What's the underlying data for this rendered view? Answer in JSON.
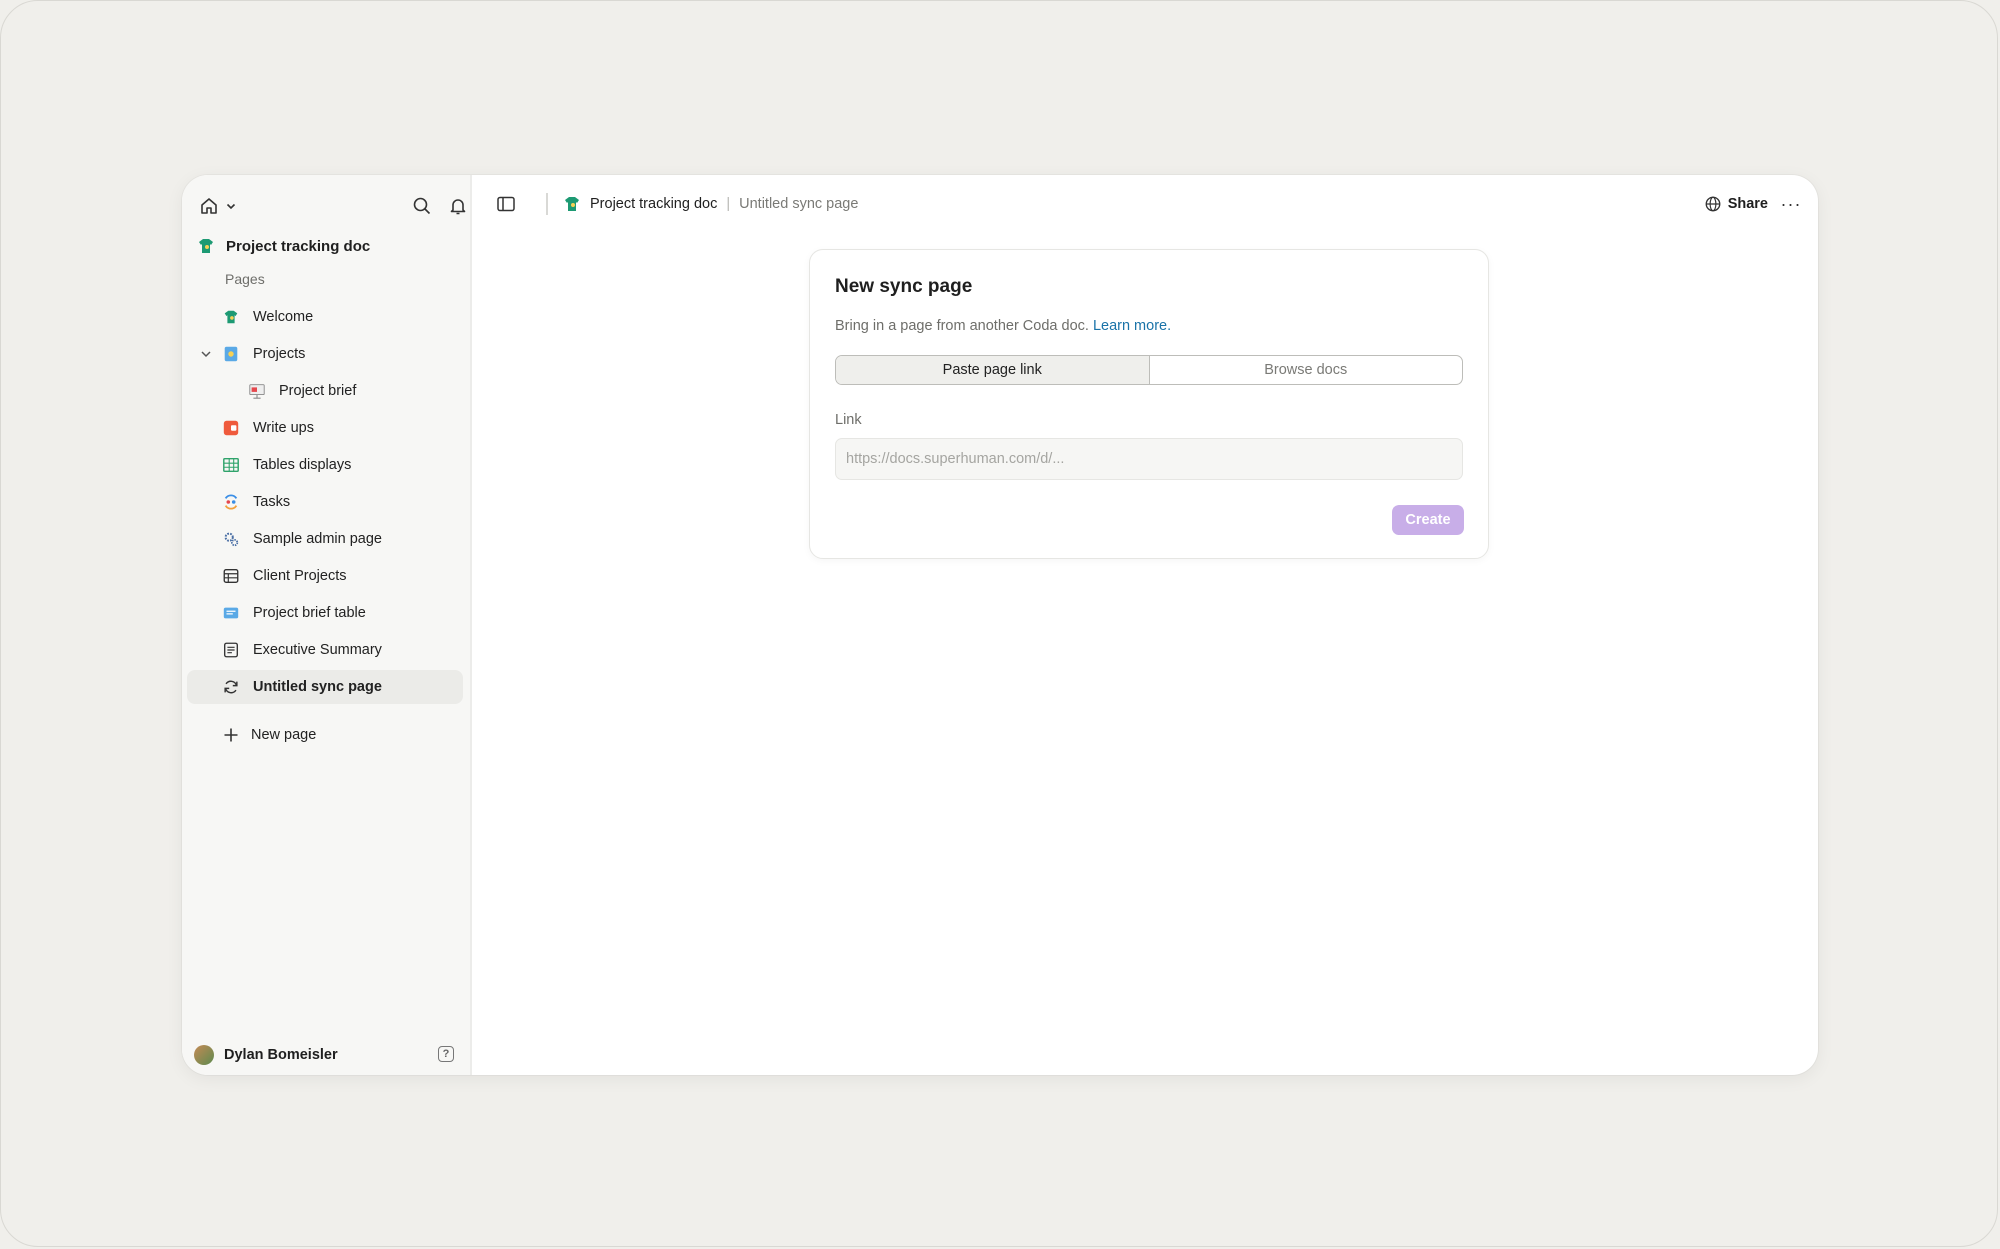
{
  "sidebar": {
    "doc_title": "Project tracking doc",
    "section_label": "Pages",
    "items": [
      {
        "label": "Welcome"
      },
      {
        "label": "Projects"
      },
      {
        "label": "Project brief"
      },
      {
        "label": "Write ups"
      },
      {
        "label": "Tables displays"
      },
      {
        "label": "Tasks"
      },
      {
        "label": "Sample admin page"
      },
      {
        "label": "Client Projects"
      },
      {
        "label": "Project brief table"
      },
      {
        "label": "Executive Summary"
      },
      {
        "label": "Untitled sync page"
      }
    ],
    "new_page_label": "New page",
    "user_name": "Dylan Bomeisler",
    "help_label": "?"
  },
  "topbar": {
    "doc_title": "Project tracking doc",
    "separator": "|",
    "current_page": "Untitled sync page",
    "share_label": "Share",
    "more_label": "···"
  },
  "dialog": {
    "title": "New sync page",
    "description": "Bring in a page from another Coda doc.",
    "learn_more": "Learn more.",
    "tabs": [
      {
        "label": "Paste page link",
        "selected": true
      },
      {
        "label": "Browse docs",
        "selected": false
      }
    ],
    "link_label": "Link",
    "link_placeholder": "https://docs.superhuman.com/d/...",
    "link_value": "",
    "create_label": "Create"
  },
  "colors": {
    "background": "#f0efeb",
    "sidebar_bg": "#f7f7f5",
    "accent_link": "#1a73a8",
    "create_button": "#c8aee8"
  }
}
